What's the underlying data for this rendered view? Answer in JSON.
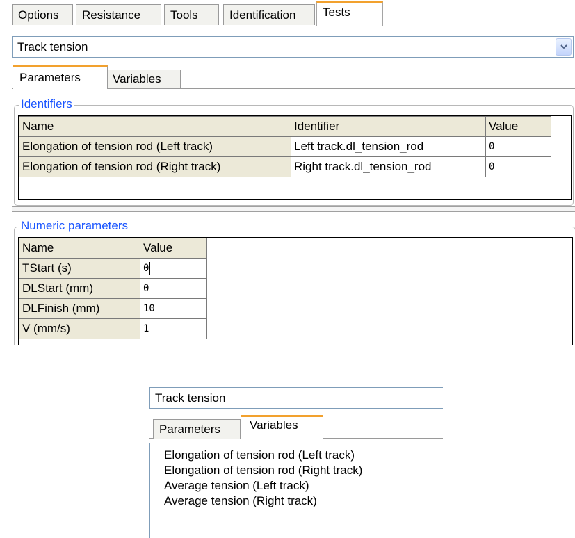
{
  "top_tabs": [
    {
      "label": "Options",
      "active": false
    },
    {
      "label": "Resistance",
      "active": false
    },
    {
      "label": "Tools",
      "active": false
    },
    {
      "label": "Identification",
      "active": false
    },
    {
      "label": "Tests",
      "active": true
    }
  ],
  "test_select": {
    "value": "Track tension",
    "icon": "chevron-down-icon"
  },
  "inner_tabs": [
    {
      "label": "Parameters",
      "active": true
    },
    {
      "label": "Variables",
      "active": false
    }
  ],
  "identifiers": {
    "title": "Identifiers",
    "columns": [
      "Name",
      "Identifier",
      "Value"
    ],
    "rows": [
      {
        "name": "Elongation of tension rod (Left track)",
        "identifier": "Left track.dl_tension_rod",
        "value": "0"
      },
      {
        "name": "Elongation of tension rod (Right track)",
        "identifier": "Right track.dl_tension_rod",
        "value": "0"
      }
    ]
  },
  "numeric_params": {
    "title": "Numeric parameters",
    "columns": [
      "Name",
      "Value"
    ],
    "rows": [
      {
        "name": "TStart (s)",
        "value": "0"
      },
      {
        "name": "DLStart (mm)",
        "value": "0"
      },
      {
        "name": "DLFinish (mm)",
        "value": "10"
      },
      {
        "name": "V (mm/s)",
        "value": "1"
      }
    ]
  },
  "second_panel": {
    "select_value": "Track tension",
    "tabs": [
      {
        "label": "Parameters",
        "active": false
      },
      {
        "label": "Variables",
        "active": true
      }
    ],
    "variables": [
      "Elongation of tension rod (Left track)",
      "Elongation of tension rod (Right track)",
      "Average tension (Left track)",
      "Average tension (Right track)"
    ]
  },
  "colors": {
    "active_tab_accent": "#f2a12e",
    "group_title": "#1a55ff",
    "header_bg": "#ece9d8"
  }
}
